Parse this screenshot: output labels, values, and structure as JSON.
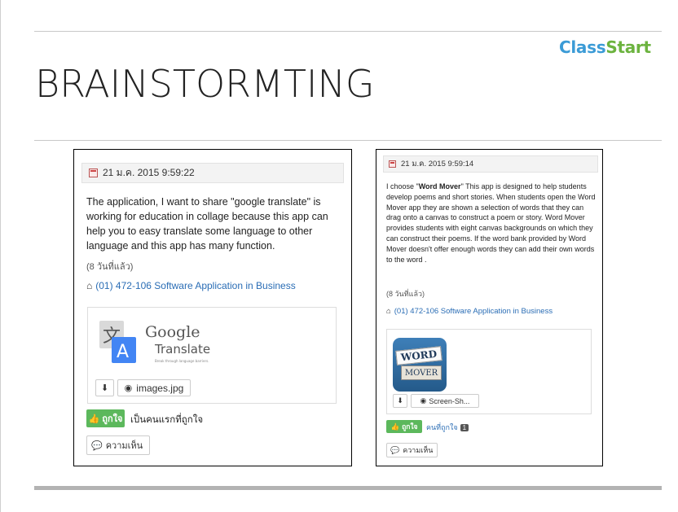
{
  "slide": {
    "brand_part1": "Class",
    "brand_part2": "Start",
    "title": "BRAINSTORMTING"
  },
  "posts": [
    {
      "date": "21 ม.ค. 2015 9:59:22",
      "body": "The application, I want to share \"google translate\" is working for education in collage because this app can help you to easy translate some language to other language and this app has many function.",
      "ago": "(8 วันที่แล้ว)",
      "course": "(01) 472-106 Software Application in Business",
      "attachment": {
        "logo_word1": "Google",
        "logo_word2": "Translate",
        "logo_tagline": "Break through language barriers.",
        "file_name": "images.jpg"
      },
      "like_label": "ถูกใจ",
      "like_text": "เป็นคนแรกที่ถูกใจ",
      "comment_label": "ความเห็น"
    },
    {
      "date": "21 ม.ค. 2015 9:59:14",
      "body_prefix": "I choose \"",
      "body_bold": "Word Mover",
      "body_rest": "\" This app is designed to help students develop poems and short stories. When students open the Word Mover app they are shown a selection of words that they can drag onto a canvas to construct a poem or story. Word Mover provides students with eight canvas backgrounds on which they can construct their poems. If the word bank provided by Word Mover doesn't offer enough words they can add their own words to the word .",
      "ago": "(8 วันที่แล้ว)",
      "course": "(01) 472-106 Software Application in Business",
      "attachment": {
        "logo_word1": "WORD",
        "logo_word2": "MOVER",
        "file_name": "Screen-Sh..."
      },
      "like_label": "ถูกใจ",
      "like_text": "คนที่ถูกใจ",
      "like_count": "1",
      "comment_label": "ความเห็น"
    }
  ]
}
